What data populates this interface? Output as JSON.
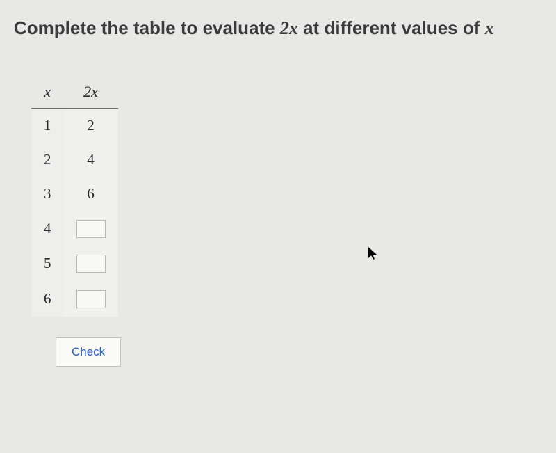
{
  "instruction": {
    "prefix": "Complete the table to evaluate ",
    "expr": "2x",
    "middle": " at different values of ",
    "var": "x"
  },
  "table": {
    "header_x": "x",
    "header_2x": "2x",
    "rows": [
      {
        "x": "1",
        "val": "2",
        "input": false
      },
      {
        "x": "2",
        "val": "4",
        "input": false
      },
      {
        "x": "3",
        "val": "6",
        "input": false
      },
      {
        "x": "4",
        "val": "",
        "input": true
      },
      {
        "x": "5",
        "val": "",
        "input": true
      },
      {
        "x": "6",
        "val": "",
        "input": true
      }
    ]
  },
  "check_label": "Check"
}
